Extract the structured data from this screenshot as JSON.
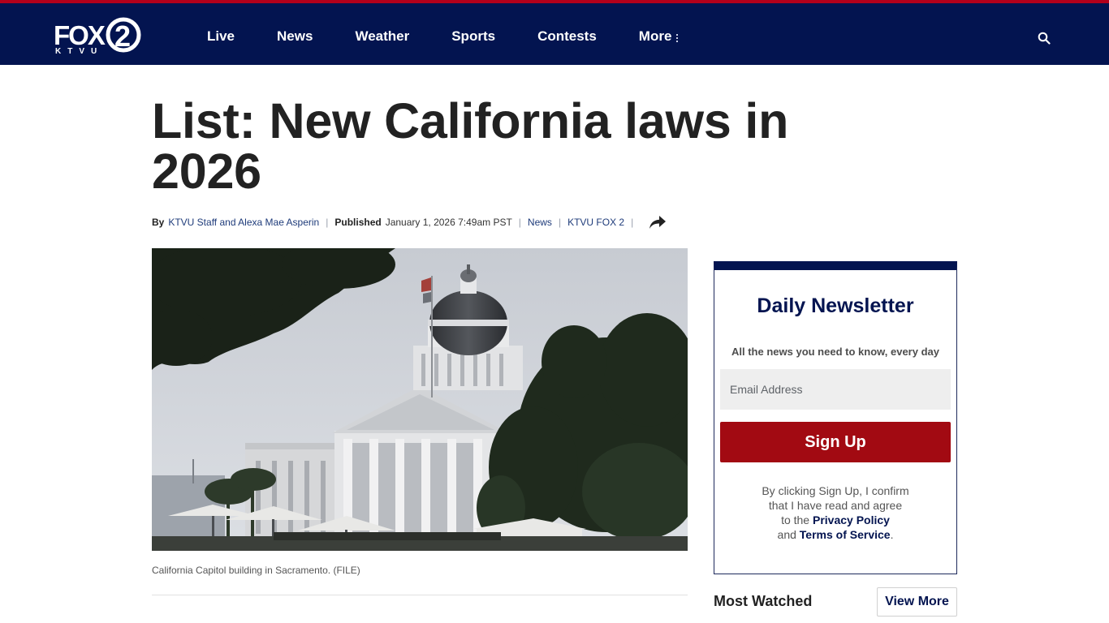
{
  "brand": {
    "logo_main": "FOX",
    "logo_numeral": "2",
    "logo_sub": "KTVU",
    "colors": {
      "nav_bg": "#031450",
      "top_line": "#b3001b",
      "signup_bg": "#a20a12",
      "link": "#031450"
    }
  },
  "nav": {
    "items": [
      {
        "label": "Live"
      },
      {
        "label": "News"
      },
      {
        "label": "Weather"
      },
      {
        "label": "Sports"
      },
      {
        "label": "Contests"
      },
      {
        "label": "More"
      }
    ],
    "more_icon": "vertical-dots-icon",
    "search_icon": "search-icon"
  },
  "article": {
    "headline": "List: New California laws in 2026",
    "byline": {
      "by_label": "By",
      "authors": "KTVU Staff and Alexa Mae Asperin",
      "published_label": "Published",
      "published_date": "January 1, 2026 7:49am PST",
      "category": "News",
      "station": "KTVU FOX 2",
      "separator": "|",
      "share_icon": "share-arrow-icon"
    },
    "image_alt": "California Capitol building in Sacramento",
    "caption": "California Capitol building in Sacramento. (FILE)"
  },
  "newsletter": {
    "title": "Daily Newsletter",
    "subtitle": "All the news you need to know, every day",
    "email_placeholder": "Email Address",
    "signup_label": "Sign Up",
    "legal": {
      "line1": "By clicking Sign Up, I confirm",
      "line2": "that I have read and agree",
      "line3_prefix": "to the",
      "privacy_link": "Privacy Policy",
      "line4_prefix": "and",
      "terms_link": "Terms of Service",
      "line4_suffix": "."
    }
  },
  "most_watched": {
    "title": "Most Watched",
    "view_more_label": "View More"
  }
}
